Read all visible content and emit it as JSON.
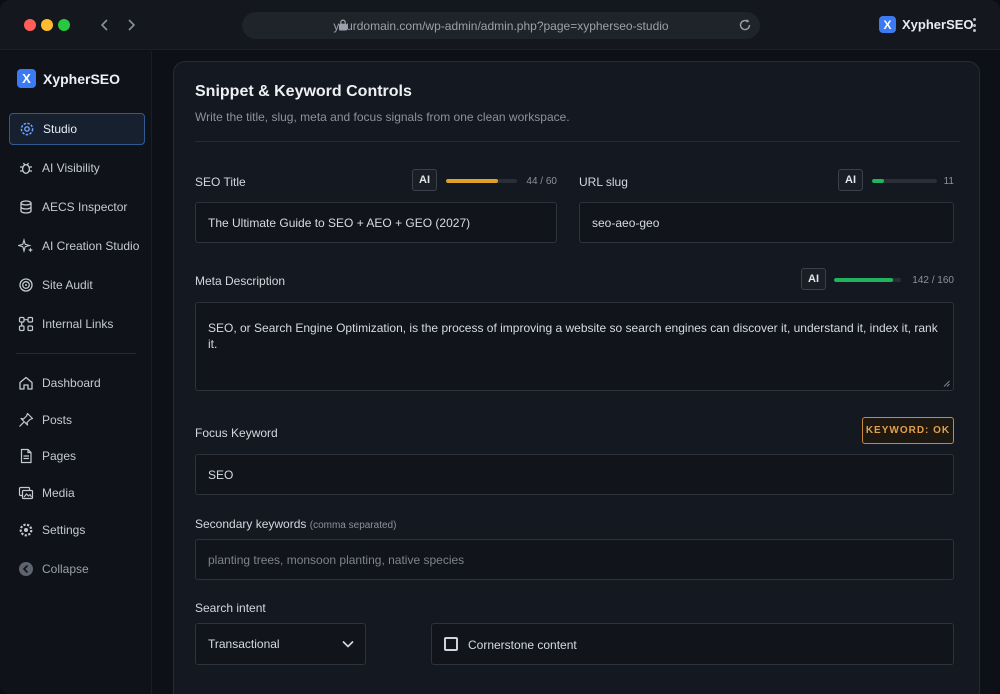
{
  "browser": {
    "url": "yourdomain.com/wp-admin/admin.php?page=xypherseo-studio",
    "brand": "XypherSEO",
    "logo_letter": "X"
  },
  "sidebar": {
    "brand": "XypherSEO",
    "logo_letter": "X",
    "items": [
      {
        "label": "Studio",
        "icon": "gear-icon",
        "active": true
      },
      {
        "label": "AI Visibility",
        "icon": "bug-icon"
      },
      {
        "label": "AECS Inspector",
        "icon": "stack-icon"
      },
      {
        "label": "AI Creation Studio",
        "icon": "sparkle-icon"
      },
      {
        "label": "Site Audit",
        "icon": "target-icon"
      },
      {
        "label": "Internal Links",
        "icon": "link-nodes-icon"
      },
      {
        "label": "Dashboard",
        "icon": "home-icon"
      },
      {
        "label": "Posts",
        "icon": "pin-icon"
      },
      {
        "label": "Pages",
        "icon": "page-icon"
      },
      {
        "label": "Media",
        "icon": "media-icon"
      },
      {
        "label": "Settings",
        "icon": "settings-icon"
      },
      {
        "label": "Collapse",
        "icon": "collapse-icon"
      }
    ]
  },
  "panel": {
    "title": "Snippet & Keyword Controls",
    "subtitle": "Write the title, slug, meta and focus signals from one clean workspace."
  },
  "seo_title": {
    "label": "SEO Title",
    "ai": "AI",
    "count": "44 / 60",
    "progress": 0.733,
    "color": "#e0a126",
    "value": "The Ultimate Guide to SEO + AEO + GEO (2027)"
  },
  "url_slug": {
    "label": "URL slug",
    "ai": "AI",
    "count": "11",
    "progress": 0.18,
    "color": "#22b35f",
    "value": "seo-aeo-geo"
  },
  "meta_description": {
    "label": "Meta Description",
    "ai": "AI",
    "count": "142 / 160",
    "progress": 0.8875,
    "color": "#22b35f",
    "value": "SEO, or Search Engine Optimization, is the process of improving a website so search engines can discover it, understand it, index it, rank it."
  },
  "focus_keyword": {
    "label": "Focus Keyword",
    "badge": "KEYWORD: OK",
    "value": "SEO"
  },
  "secondary_keywords": {
    "label": "Secondary keywords",
    "hint": "(comma separated)",
    "placeholder": "planting trees, monsoon planting, native species"
  },
  "search_intent": {
    "label": "Search intent",
    "selected": "Transactional"
  },
  "cornerstone": {
    "label": "Cornerstone content",
    "checked": false
  }
}
